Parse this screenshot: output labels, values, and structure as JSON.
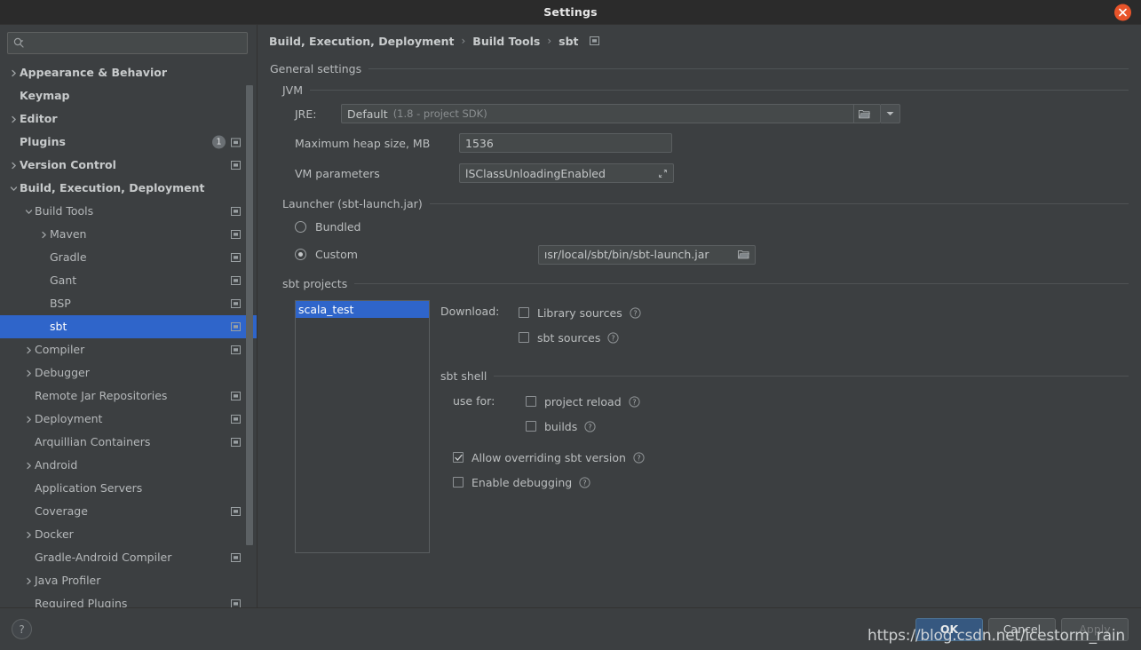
{
  "window": {
    "title": "Settings",
    "close_icon": "close-icon"
  },
  "sidebar": {
    "search": {
      "placeholder": "",
      "value": "",
      "icon": "search-icon"
    },
    "items": [
      {
        "label": "Appearance & Behavior",
        "arrow": "chevron-right",
        "indent": 0,
        "bold": true,
        "badge": "",
        "mod": false
      },
      {
        "label": "Keymap",
        "arrow": "",
        "indent": 0,
        "bold": true,
        "badge": "",
        "mod": false
      },
      {
        "label": "Editor",
        "arrow": "chevron-right",
        "indent": 0,
        "bold": true,
        "badge": "",
        "mod": false
      },
      {
        "label": "Plugins",
        "arrow": "",
        "indent": 0,
        "bold": true,
        "badge": "1",
        "mod": true
      },
      {
        "label": "Version Control",
        "arrow": "chevron-right",
        "indent": 0,
        "bold": true,
        "badge": "",
        "mod": true
      },
      {
        "label": "Build, Execution, Deployment",
        "arrow": "chevron-down",
        "indent": 0,
        "bold": true,
        "badge": "",
        "mod": false
      },
      {
        "label": "Build Tools",
        "arrow": "chevron-down",
        "indent": 1,
        "bold": false,
        "badge": "",
        "mod": true
      },
      {
        "label": "Maven",
        "arrow": "chevron-right",
        "indent": 2,
        "bold": false,
        "badge": "",
        "mod": true
      },
      {
        "label": "Gradle",
        "arrow": "",
        "indent": 2,
        "bold": false,
        "badge": "",
        "mod": true
      },
      {
        "label": "Gant",
        "arrow": "",
        "indent": 2,
        "bold": false,
        "badge": "",
        "mod": true
      },
      {
        "label": "BSP",
        "arrow": "",
        "indent": 2,
        "bold": false,
        "badge": "",
        "mod": true
      },
      {
        "label": "sbt",
        "arrow": "",
        "indent": 2,
        "bold": false,
        "badge": "",
        "mod": true,
        "selected": true
      },
      {
        "label": "Compiler",
        "arrow": "chevron-right",
        "indent": 1,
        "bold": false,
        "badge": "",
        "mod": true
      },
      {
        "label": "Debugger",
        "arrow": "chevron-right",
        "indent": 1,
        "bold": false,
        "badge": "",
        "mod": false
      },
      {
        "label": "Remote Jar Repositories",
        "arrow": "",
        "indent": 1,
        "bold": false,
        "badge": "",
        "mod": true
      },
      {
        "label": "Deployment",
        "arrow": "chevron-right",
        "indent": 1,
        "bold": false,
        "badge": "",
        "mod": true
      },
      {
        "label": "Arquillian Containers",
        "arrow": "",
        "indent": 1,
        "bold": false,
        "badge": "",
        "mod": true
      },
      {
        "label": "Android",
        "arrow": "chevron-right",
        "indent": 1,
        "bold": false,
        "badge": "",
        "mod": false
      },
      {
        "label": "Application Servers",
        "arrow": "",
        "indent": 1,
        "bold": false,
        "badge": "",
        "mod": false
      },
      {
        "label": "Coverage",
        "arrow": "",
        "indent": 1,
        "bold": false,
        "badge": "",
        "mod": true
      },
      {
        "label": "Docker",
        "arrow": "chevron-right",
        "indent": 1,
        "bold": false,
        "badge": "",
        "mod": false
      },
      {
        "label": "Gradle-Android Compiler",
        "arrow": "",
        "indent": 1,
        "bold": false,
        "badge": "",
        "mod": true
      },
      {
        "label": "Java Profiler",
        "arrow": "chevron-right",
        "indent": 1,
        "bold": false,
        "badge": "",
        "mod": false
      },
      {
        "label": "Required Plugins",
        "arrow": "",
        "indent": 1,
        "bold": false,
        "badge": "",
        "mod": true
      }
    ]
  },
  "breadcrumb": {
    "items": [
      "Build, Execution, Deployment",
      "Build Tools",
      "sbt"
    ],
    "separator": "›",
    "trailing_icon": "project-settings-icon"
  },
  "general": {
    "title": "General settings",
    "jvm": {
      "title": "JVM",
      "jre_label": "JRE:",
      "jre_value": "Default",
      "jre_hint": "(1.8 - project SDK)",
      "jre_browse_icon": "folder-icon",
      "jre_dropdown_icon": "chevron-down-icon",
      "heap_label": "Maximum heap size, MB",
      "heap_value": "1536",
      "vm_label": "VM parameters",
      "vm_value": "lSClassUnloadingEnabled",
      "vm_expand_icon": "expand-icon"
    },
    "launcher": {
      "title": "Launcher (sbt-launch.jar)",
      "options": [
        {
          "label": "Bundled",
          "selected": false
        },
        {
          "label": "Custom",
          "selected": true
        }
      ],
      "custom_path": "ısr/local/sbt/bin/sbt-launch.jar",
      "custom_browse_icon": "folder-icon"
    },
    "projects": {
      "title": "sbt projects",
      "list": [
        {
          "label": "scala_test",
          "selected": true
        }
      ],
      "download_label": "Download:",
      "download_options": [
        {
          "label": "Library sources",
          "checked": false,
          "help": "help-icon"
        },
        {
          "label": "sbt sources",
          "checked": false,
          "help": "help-icon"
        }
      ],
      "shell_title": "sbt shell",
      "use_for_label": "use for:",
      "use_for_options": [
        {
          "label": "project reload",
          "checked": false,
          "help": "help-icon"
        },
        {
          "label": "builds",
          "checked": false,
          "help": "help-icon"
        }
      ],
      "extra_options": [
        {
          "label": "Allow overriding sbt version",
          "checked": true,
          "help": "help-icon"
        },
        {
          "label": "Enable debugging",
          "checked": false,
          "help": "help-icon"
        }
      ]
    }
  },
  "footer": {
    "help_label": "?",
    "ok_label": "OK",
    "cancel_label": "Cancel",
    "apply_label": "Apply"
  },
  "watermark": "https://blog.csdn.net/icestorm_rain",
  "colors": {
    "accent_selection": "#2f65ca",
    "window_bg": "#3c3f41",
    "titlebar_bg": "#2b2b2b",
    "close_button": "#e8542a",
    "primary_button": "#365880"
  }
}
